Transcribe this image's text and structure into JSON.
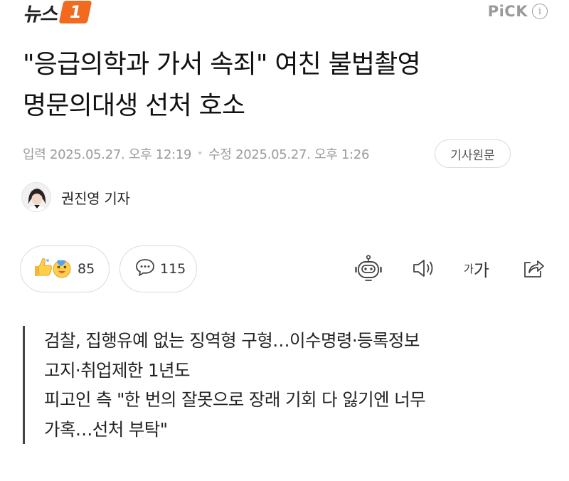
{
  "header": {
    "logo_text": "뉴스",
    "logo_badge": "1",
    "pick_label": "PiCK",
    "info_icon": "i"
  },
  "article": {
    "title_line1": "\"응급의학과 가서 속죄\" 여친 불법촬영",
    "title_line2": "명문의대생 선처 호소",
    "published": "입력 2025.05.27. 오후 12:19",
    "modified": "수정 2025.05.27. 오후 1:26",
    "separator": "•",
    "origin_button": "기사원문",
    "reporter": "권진영 기자"
  },
  "actions": {
    "reaction_count": "85",
    "comment_count": "115",
    "font_small": "가",
    "font_large": "가"
  },
  "summary": {
    "line1": "검찰, 집행유예 없는 징역형 구형…이수명령·등록정보",
    "line2": "고지·취업제한 1년도",
    "line3": "피고인 측 \"한 번의 잘못으로 장래 기회 다 잃기엔 너무",
    "line4": "가혹…선처 부탁\""
  },
  "colors": {
    "brand_orange": "#f26a20",
    "meta_gray": "#9b9b9b",
    "border_gray": "#dcdcdc"
  }
}
